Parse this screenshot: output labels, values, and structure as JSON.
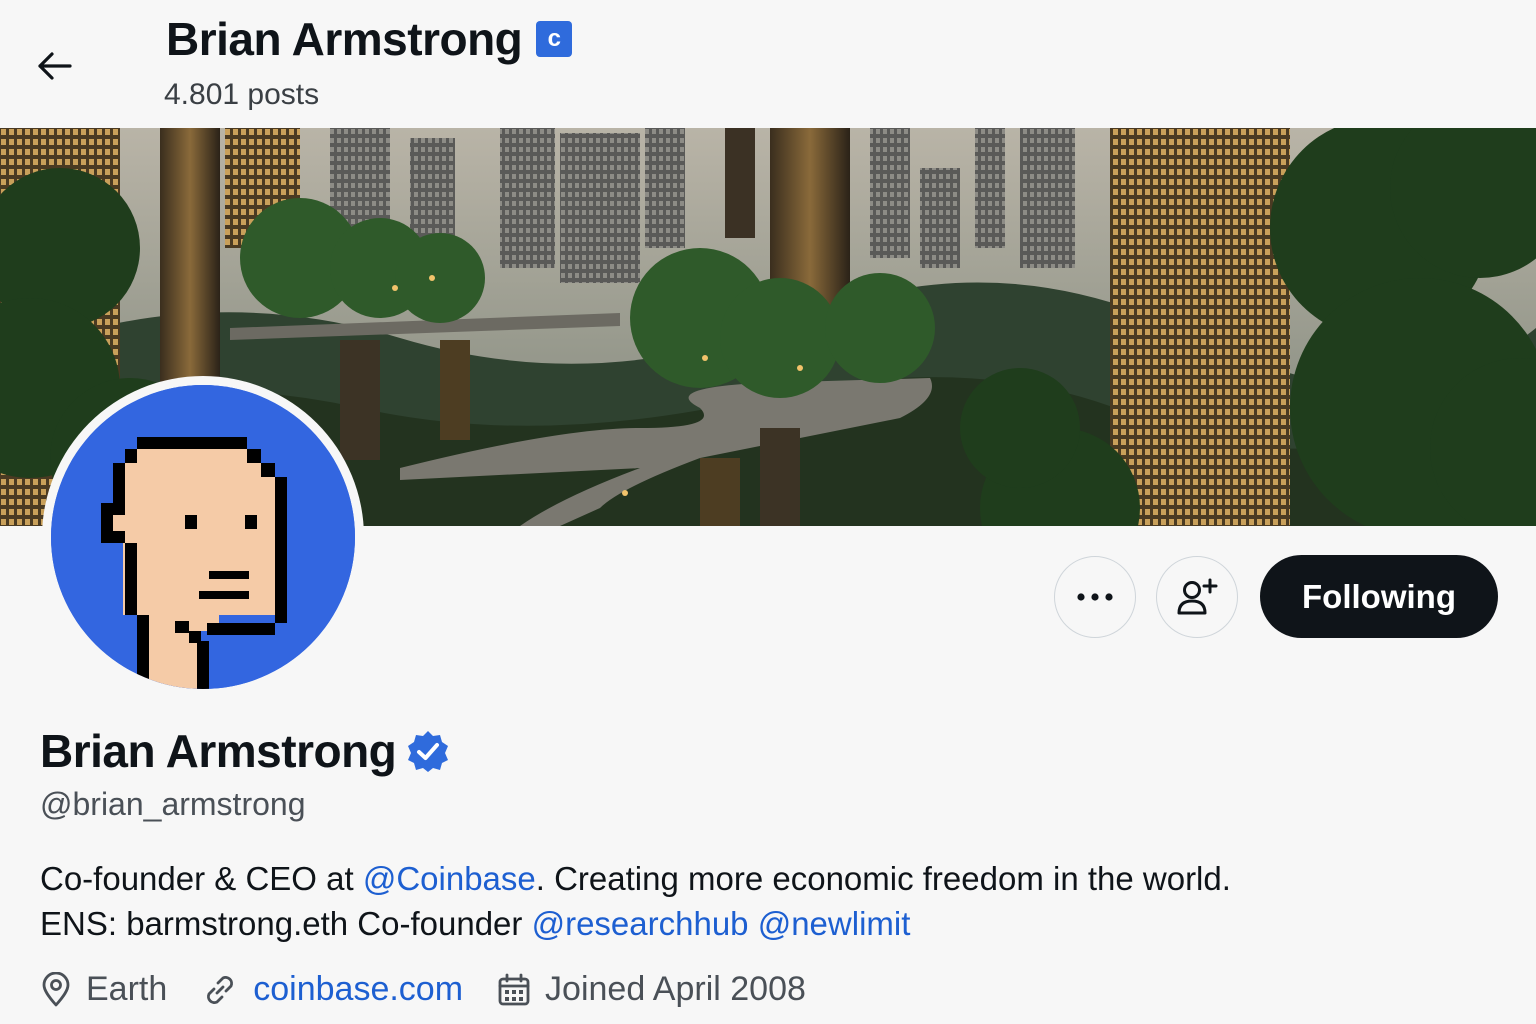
{
  "header": {
    "name": "Brian Armstrong",
    "badge_letter": "c",
    "posts": "4.801 posts"
  },
  "profile": {
    "name": "Brian Armstrong",
    "handle": "@brian_armstrong",
    "bio_line1_prefix": "Co-founder & CEO at ",
    "bio_mention_coinbase": "@Coinbase",
    "bio_line1_suffix": ". Creating more economic freedom in the world.",
    "bio_line2_prefix": "ENS: barmstrong.eth Co-founder ",
    "bio_mention_researchhub": "@researchhub",
    "bio_mention_newlimit": "@newlimit",
    "location": "Earth",
    "website": "coinbase.com",
    "joined": "Joined April 2008"
  },
  "actions": {
    "following_label": "Following"
  },
  "colors": {
    "accent_link": "#1d5fd1",
    "verified_blue": "#2f6bdc",
    "avatar_bg": "#3366e0"
  }
}
